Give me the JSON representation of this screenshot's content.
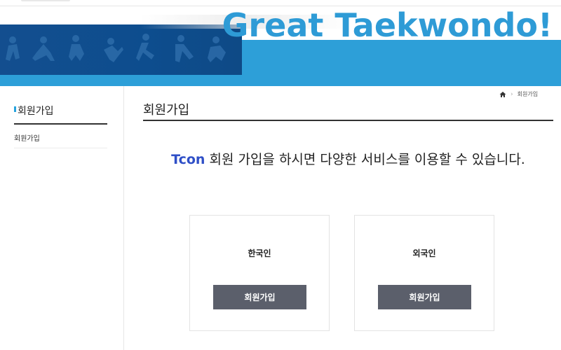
{
  "banner": {
    "title": "Great Taekwondo!"
  },
  "sidebar": {
    "title": "회원가입",
    "items": [
      {
        "label": "회원가입"
      }
    ]
  },
  "breadcrumb": {
    "current": "회원가입"
  },
  "main": {
    "page_title": "회원가입",
    "intro_brand": "Tcon",
    "intro_text": " 회원 가입을 하시면 다양한 서비스를 이용할 수 있습니다.",
    "cards": [
      {
        "label": "한국인",
        "button": "회원가입"
      },
      {
        "label": "외국인",
        "button": "회원가입"
      }
    ]
  },
  "colors": {
    "banner_band": "#2d9fd8",
    "banner_title": "#2e9bd6",
    "brand_text": "#2f4fc7",
    "button_bg": "#5b5f6b",
    "accent": "#27a3de"
  }
}
